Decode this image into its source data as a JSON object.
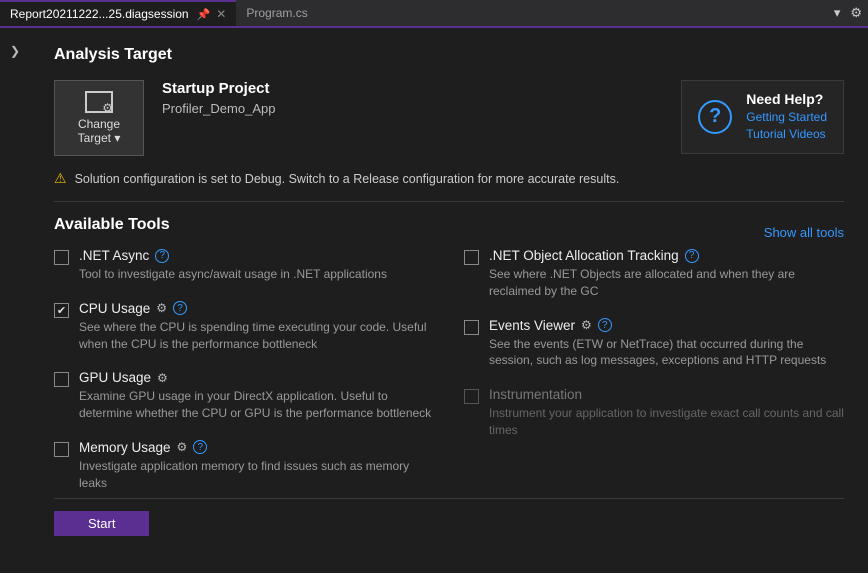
{
  "tabs": {
    "active": "Report20211222...25.diagsession",
    "inactive": "Program.cs"
  },
  "sections": {
    "analysis_target": "Analysis Target",
    "available_tools": "Available Tools"
  },
  "change_target": {
    "line1": "Change",
    "line2": "Target ▾"
  },
  "project": {
    "title": "Startup Project",
    "name": "Profiler_Demo_App"
  },
  "help": {
    "title": "Need Help?",
    "link1": "Getting Started",
    "link2": "Tutorial Videos"
  },
  "warning": "Solution configuration is set to Debug. Switch to a Release configuration for more accurate results.",
  "show_all": "Show all tools",
  "tools": {
    "net_async": {
      "name": ".NET Async",
      "desc": "Tool to investigate async/await usage in .NET applications",
      "checked": false,
      "has_gear": false,
      "has_info": true,
      "disabled": false
    },
    "cpu": {
      "name": "CPU Usage",
      "desc": "See where the CPU is spending time executing your code. Useful when the CPU is the performance bottleneck",
      "checked": true,
      "has_gear": true,
      "has_info": true,
      "disabled": false
    },
    "gpu": {
      "name": "GPU Usage",
      "desc": "Examine GPU usage in your DirectX application. Useful to determine whether the CPU or GPU is the performance bottleneck",
      "checked": false,
      "has_gear": true,
      "has_info": false,
      "disabled": false
    },
    "memory": {
      "name": "Memory Usage",
      "desc": "Investigate application memory to find issues such as memory leaks",
      "checked": false,
      "has_gear": true,
      "has_info": true,
      "disabled": false
    },
    "alloc": {
      "name": ".NET Object Allocation Tracking",
      "desc": "See where .NET Objects are allocated and when they are reclaimed by the GC",
      "checked": false,
      "has_gear": false,
      "has_info": true,
      "disabled": false
    },
    "events": {
      "name": "Events Viewer",
      "desc": "See the events (ETW or NetTrace) that occurred during the session, such as log messages, exceptions and HTTP requests",
      "checked": false,
      "has_gear": true,
      "has_info": true,
      "disabled": false
    },
    "instr": {
      "name": "Instrumentation",
      "desc": "Instrument your application to investigate exact call counts and call times",
      "checked": false,
      "has_gear": false,
      "has_info": false,
      "disabled": true
    }
  },
  "start_button": "Start"
}
